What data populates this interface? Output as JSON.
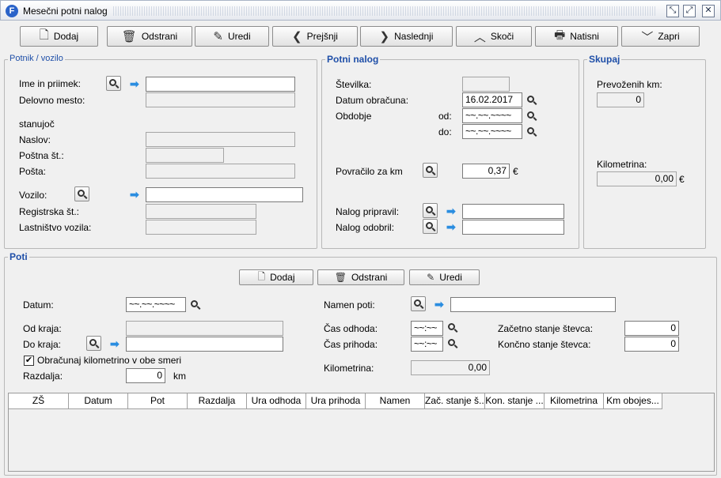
{
  "window": {
    "title": "Mesečni potni nalog",
    "app_icon_letter": "F"
  },
  "toolbar": [
    {
      "label": "Dodaj",
      "icon": "add-document-icon"
    },
    {
      "label": "Odstrani",
      "icon": "trash-icon"
    },
    {
      "label": "Uredi",
      "icon": "edit-icon"
    },
    {
      "label": "Prejšnji",
      "icon": "chevron-left-icon"
    },
    {
      "label": "Naslednji",
      "icon": "chevron-right-icon"
    },
    {
      "label": "Skoči",
      "icon": "chevron-up-icon"
    },
    {
      "label": "Natisni",
      "icon": "print-icon"
    },
    {
      "label": "Zapri",
      "icon": "chevron-down-icon"
    }
  ],
  "potnik": {
    "legend": "Potnik / vozilo",
    "ime_label": "Ime in priimek:",
    "ime_value": "",
    "delovno_label": "Delovno mesto:",
    "stanujoc_label": "stanujoč",
    "naslov_label": "Naslov:",
    "postna_label": "Poštna št.:",
    "posta_label": "Pošta:",
    "vozilo_label": "Vozilo:",
    "vozilo_value": "",
    "registrska_label": "Registrska št.:",
    "lastnistvo_label": "Lastništvo vozila:"
  },
  "nalog": {
    "legend": "Potni nalog",
    "stevilka_label": "Številka:",
    "datum_label": "Datum obračuna:",
    "datum_value": "16.02.2017",
    "obdobje_label": "Obdobje",
    "od_label": "od:",
    "od_value": "~~.~~.~~~~",
    "do_label": "do:",
    "do_value": "~~.~~.~~~~",
    "povracilo_label": "Povračilo za km",
    "povracilo_value": "0,37",
    "currency": "€",
    "pripravil_label": "Nalog pripravil:",
    "odobril_label": "Nalog odobril:"
  },
  "skupaj": {
    "legend": "Skupaj",
    "km_label": "Prevoženih km:",
    "km_value": "0",
    "kilometrina_label": "Kilometrina:",
    "kilometrina_value": "0,00",
    "currency": "€"
  },
  "poti": {
    "legend": "Poti",
    "buttons": [
      {
        "label": "Dodaj",
        "icon": "add-document-icon"
      },
      {
        "label": "Odstrani",
        "icon": "trash-icon"
      },
      {
        "label": "Uredi",
        "icon": "edit-icon"
      }
    ],
    "datum_label": "Datum:",
    "datum_value": "~~.~~.~~~~",
    "od_kraja_label": "Od kraja:",
    "do_kraja_label": "Do kraja:",
    "obe_smeri_label": "Obračunaj kilometrino v obe smeri",
    "obe_smeri_checked": true,
    "razdalja_label": "Razdalja:",
    "razdalja_value": "0",
    "razdalja_unit": "km",
    "namen_label": "Namen poti:",
    "cas_odhoda_label": "Čas odhoda:",
    "cas_odhoda_value": "~~:~~",
    "cas_prihoda_label": "Čas prihoda:",
    "cas_prihoda_value": "~~:~~",
    "kilometrina_label": "Kilometrina:",
    "kilometrina_value": "0,00",
    "zacetno_label": "Začetno stanje števca:",
    "zacetno_value": "0",
    "koncno_label": "Končno stanje števca:",
    "koncno_value": "0"
  },
  "grid": {
    "columns": [
      "ZŠ",
      "Datum",
      "Pot",
      "Razdalja",
      "Ura odhoda",
      "Ura prihoda",
      "Namen",
      "Zač. stanje š...",
      "Kon. stanje ...",
      "Kilometrina",
      "Km obojes..."
    ]
  }
}
